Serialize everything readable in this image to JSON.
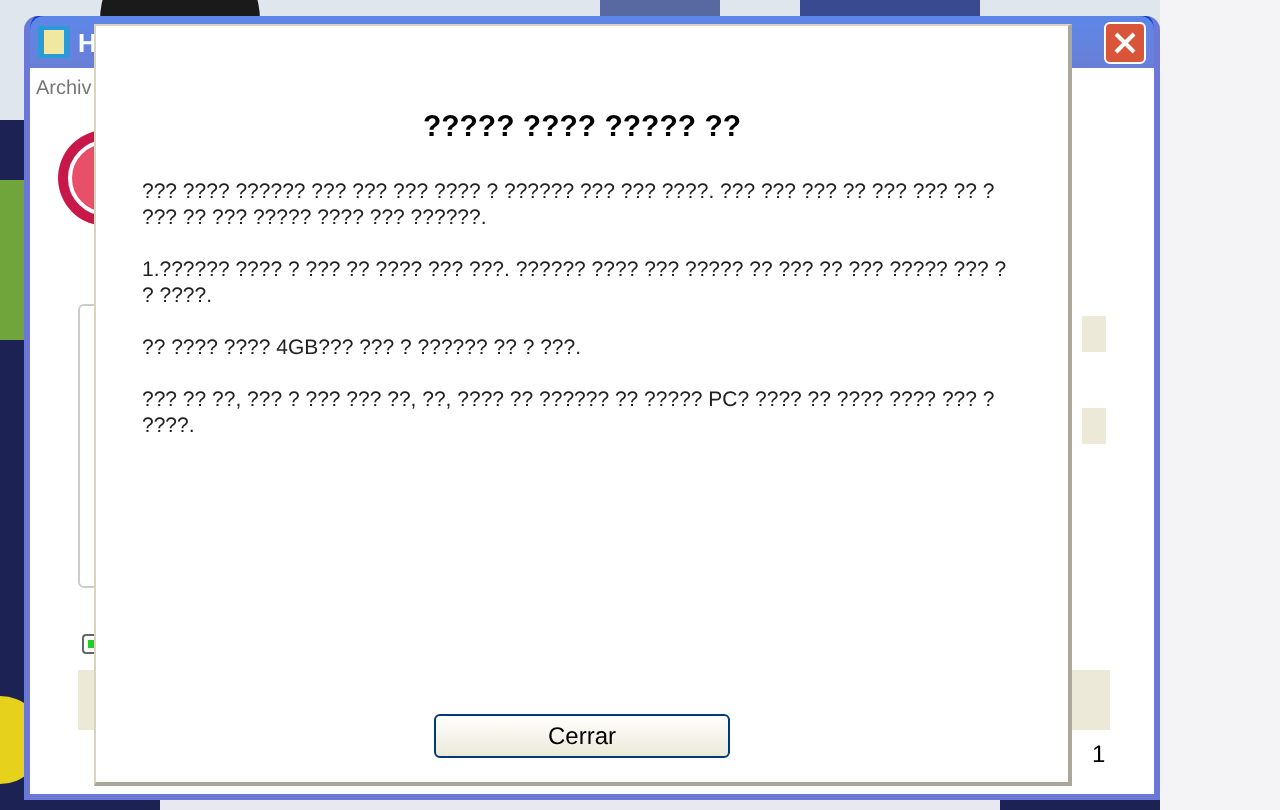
{
  "background_window": {
    "title": "H",
    "menu": [
      "Archiv"
    ],
    "status_text": "1",
    "checkbox": {
      "checked": true
    }
  },
  "dialog": {
    "title": "????? ???? ????? ??",
    "paragraphs": [
      "??? ???? ?????? ??? ??? ??? ???? ? ?????? ??? ??? ????. ??? ??? ??? ?? ??? ??? ?? ? ??? ?? ??? ????? ???? ??? ??????.",
      "1.?????? ???? ? ??? ?? ???? ??? ???. ?????? ???? ??? ????? ?? ??? ?? ??? ????? ??? ? ? ????.",
      "?? ???? ???? 4GB??? ??? ? ?????? ?? ? ???.",
      "??? ?? ??, ??? ? ??? ??? ??, ??, ???? ?? ?????? ?? ????? PC? ???? ?? ???? ???? ??? ? ????."
    ],
    "button": "Cerrar"
  }
}
